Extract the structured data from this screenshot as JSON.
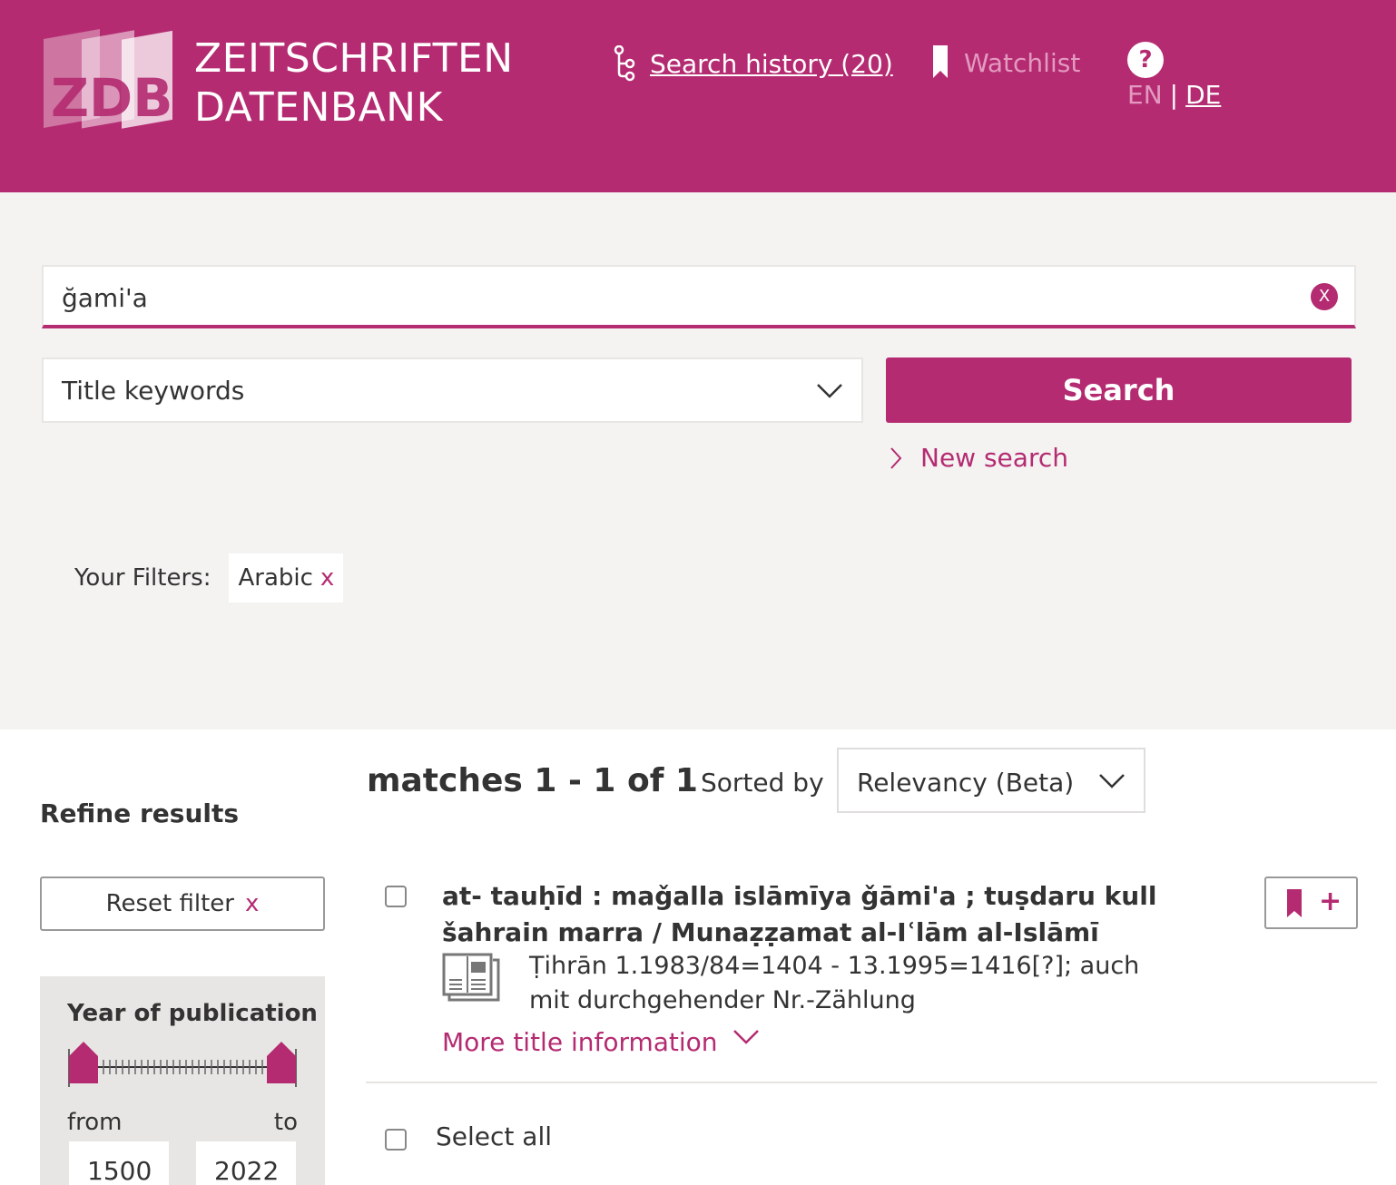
{
  "header": {
    "logo_letters": "ZDB",
    "logo_line1": "ZEITSCHRIFTEN",
    "logo_line2": "DATENBANK",
    "search_history": "Search history (20)",
    "watchlist": "Watchlist",
    "help_glyph": "?",
    "lang_en": "EN",
    "lang_sep": "|",
    "lang_de": "DE"
  },
  "search": {
    "query": "ğami'a",
    "clear_glyph": "X",
    "field": "Title keywords",
    "button": "Search",
    "new_search": "New search"
  },
  "filters": {
    "label": "Your Filters:",
    "chips": [
      {
        "label": "Arabic",
        "remove": "x"
      }
    ]
  },
  "refine": {
    "title": "Refine results",
    "reset": "Reset filter",
    "reset_x": "x",
    "year": {
      "title": "Year of publication",
      "from_label": "from",
      "to_label": "to",
      "from": "1500",
      "to": "2022"
    }
  },
  "results": {
    "matches": "matches 1 - 1  of 1",
    "sorted_by": "Sorted by",
    "sort_value": "Relevancy (Beta)",
    "items": [
      {
        "title": "at- tauḥīd : maǧalla islāmīya ǧāmi'a ; tuṣdaru kull šahrain marra / Munaẓẓamat al-Iʿlām al-Islāmī",
        "publication": "Ṭihrān 1.1983/84=1404 - 13.1995=1416[?]; auch mit durchgehender Nr.-Zählung",
        "more": "More title information",
        "bookmark_plus": "+"
      }
    ],
    "select_all": "Select all"
  },
  "colors": {
    "brand": "#b42b71",
    "panel": "#f4f3f2",
    "muted": "#e39ac0"
  },
  "icons": [
    "history-icon",
    "bookmark-icon",
    "help-icon",
    "clear-icon",
    "chevron-down-icon",
    "chevron-right-icon",
    "document-icon",
    "slider-handle-icon"
  ]
}
